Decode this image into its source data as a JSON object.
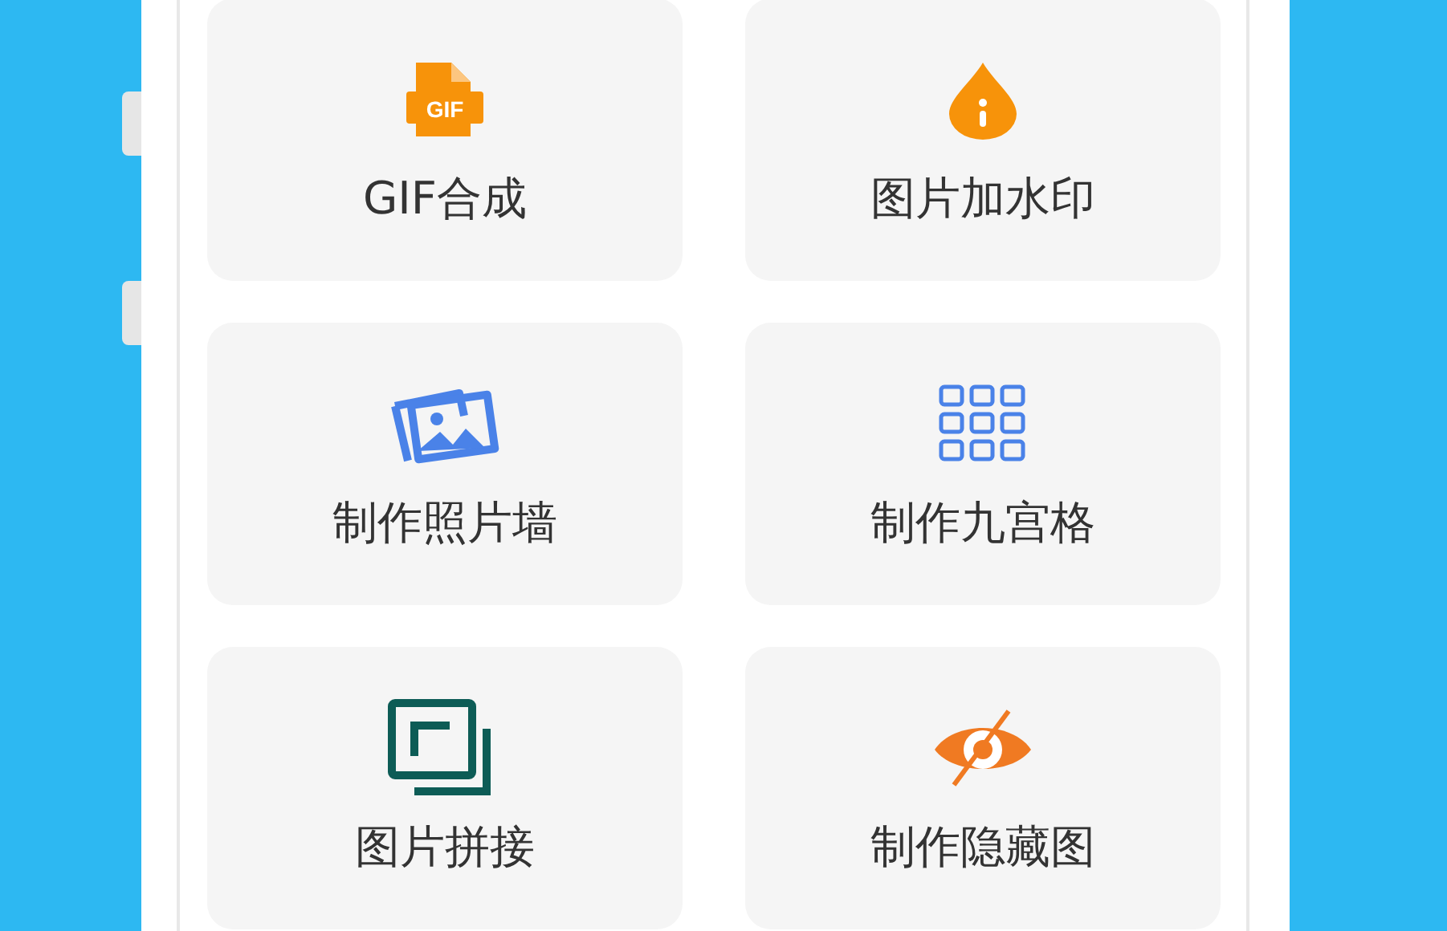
{
  "tools": [
    {
      "label": "GIF合成",
      "kind": "gif",
      "icon_text": "GIF"
    },
    {
      "label": "图片加水印",
      "kind": "drop"
    },
    {
      "label": "制作照片墙",
      "kind": "photos"
    },
    {
      "label": "制作九宫格",
      "kind": "grid"
    },
    {
      "label": "图片拼接",
      "kind": "stack"
    },
    {
      "label": "制作隐藏图",
      "kind": "eye"
    }
  ]
}
